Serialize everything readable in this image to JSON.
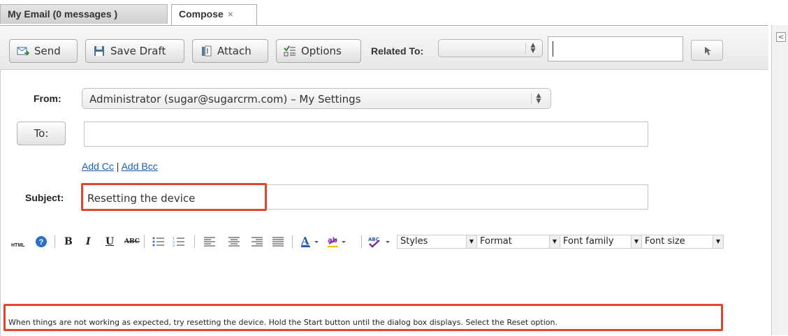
{
  "tabs": {
    "email": "My Email (0 messages )",
    "compose": "Compose",
    "compose_close": "×"
  },
  "toolbar": {
    "send": "Send",
    "save_draft": "Save Draft",
    "attach": "Attach",
    "options": "Options",
    "related_to_label": "Related To:"
  },
  "form": {
    "from_label": "From:",
    "from_value": "Administrator (sugar@sugarcrm.com) – My Settings",
    "to_button": "To:",
    "add_cc": "Add Cc",
    "link_sep": " | ",
    "add_bcc": "Add Bcc",
    "subject_label": "Subject:",
    "subject_value": "Resetting the device"
  },
  "editor": {
    "html_label": "HTML",
    "styles": "Styles",
    "format": "Format",
    "font_family": "Font family",
    "font_size": "Font size",
    "body": "When things are not working as expected, try resetting the device. Hold the Start button until the dialog box displays. Select the Reset option."
  },
  "colors": {
    "highlight": "#e2452f",
    "link": "#1a5fb4"
  }
}
